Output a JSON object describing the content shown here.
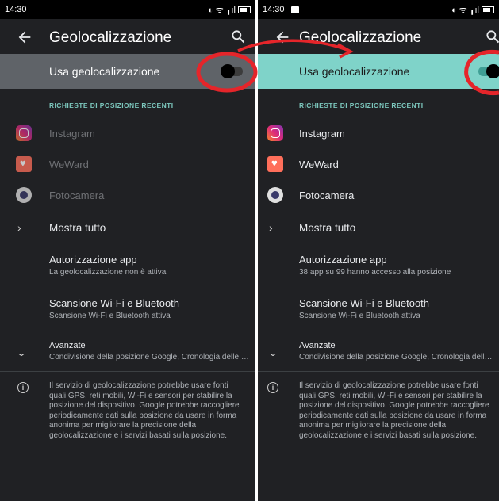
{
  "left_screen": {
    "status": {
      "time": "14:30",
      "sys_icons": "◐ ᯤ ╻ıl"
    },
    "appbar": {
      "title": "Geolocalizzazione"
    },
    "toggle": {
      "label": "Usa geolocalizzazione",
      "state": "off"
    },
    "section_header": "RICHIESTE DI POSIZIONE RECENTI",
    "recent_apps": [
      {
        "label": "Instagram",
        "icon": "instagram-icon"
      },
      {
        "label": "WeWard",
        "icon": "weward-icon"
      },
      {
        "label": "Fotocamera",
        "icon": "camera-icon"
      }
    ],
    "show_all": "Mostra tutto",
    "settings": {
      "app_permissions": {
        "title": "Autorizzazione app",
        "subtitle": "La geolocalizzazione non è attiva"
      },
      "scanning": {
        "title": "Scansione Wi-Fi e Bluetooth",
        "subtitle": "Scansione Wi-Fi e Bluetooth attiva"
      },
      "advanced": {
        "title": "Avanzate",
        "subtitle": "Condivisione della posizione Google, Cronologia delle posizioni Google"
      }
    },
    "info": "Il servizio di geolocalizzazione potrebbe usare fonti quali GPS, reti mobili, Wi-Fi e sensori per stabilire la posizione del dispositivo. Google potrebbe raccogliere periodicamente dati sulla posizione da usare in forma anonima per migliorare la precisione della geolocalizzazione e i servizi basati sulla posizione."
  },
  "right_screen": {
    "status": {
      "time": "14:30",
      "sys_icons": "◐ ᯤ ╻ıl"
    },
    "appbar": {
      "title": "Geolocalizzazione"
    },
    "toggle": {
      "label": "Usa geolocalizzazione",
      "state": "on"
    },
    "section_header": "RICHIESTE DI POSIZIONE RECENTI",
    "recent_apps": [
      {
        "label": "Instagram",
        "icon": "instagram-icon"
      },
      {
        "label": "WeWard",
        "icon": "weward-icon"
      },
      {
        "label": "Fotocamera",
        "icon": "camera-icon"
      }
    ],
    "show_all": "Mostra tutto",
    "settings": {
      "app_permissions": {
        "title": "Autorizzazione app",
        "subtitle": "38 app su 99 hanno accesso alla posizione"
      },
      "scanning": {
        "title": "Scansione Wi-Fi e Bluetooth",
        "subtitle": "Scansione Wi-Fi e Bluetooth attiva"
      },
      "advanced": {
        "title": "Avanzate",
        "subtitle": "Condivisione della posizione Google, Cronologia delle posizioni Google"
      }
    },
    "info": "Il servizio di geolocalizzazione potrebbe usare fonti quali GPS, reti mobili, Wi-Fi e sensori per stabilire la posizione del dispositivo. Google potrebbe raccogliere periodicamente dati sulla posizione da usare in forma anonima per migliorare la precisione della geolocalizzazione e i servizi basati sulla posizione."
  },
  "colors": {
    "background": "#202124",
    "toggle_row_off": "#5f6368",
    "toggle_row_on": "#7fd3c9",
    "accent_teal": "#7cc7bd",
    "annotation_red": "#e5252a"
  }
}
